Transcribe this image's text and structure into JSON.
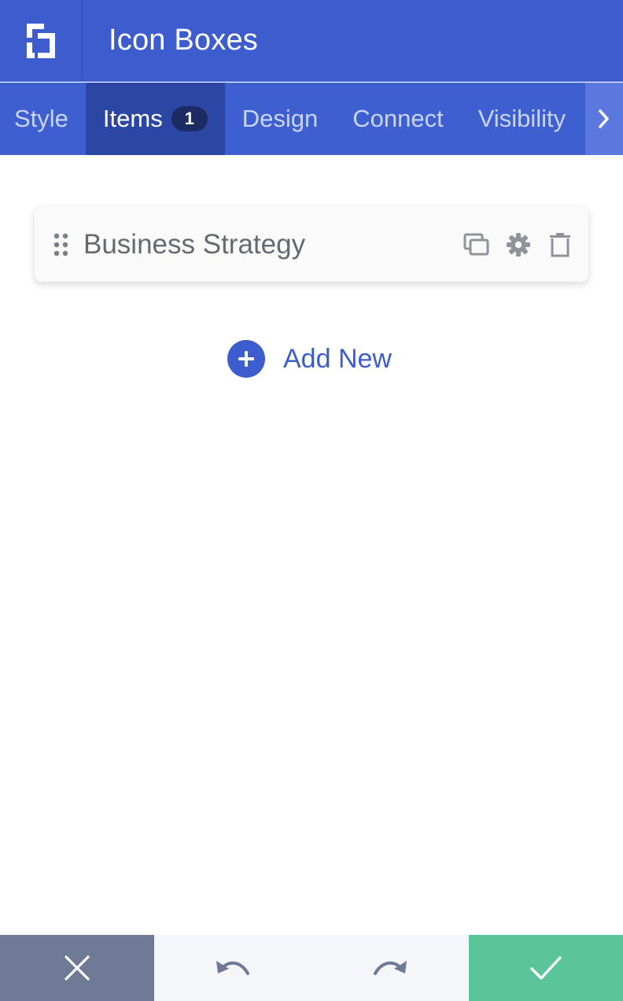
{
  "header": {
    "logo_icon": "builder-logo-icon",
    "title": "Icon Boxes"
  },
  "tabs": [
    {
      "label": "Style",
      "active": false
    },
    {
      "label": "Items",
      "active": true,
      "badge": "1"
    },
    {
      "label": "Design",
      "active": false
    },
    {
      "label": "Connect",
      "active": false
    },
    {
      "label": "Visibility",
      "active": false
    }
  ],
  "tab_scroll_icon": "chevron-right-icon",
  "items": [
    {
      "label": "Business Strategy",
      "icons": [
        "drag-handle-icon",
        "duplicate-icon",
        "settings-icon",
        "trash-icon"
      ]
    }
  ],
  "add_new": {
    "label": "Add New",
    "icon": "plus-circle-icon"
  },
  "footer": {
    "cancel_icon": "close-icon",
    "undo_icon": "undo-icon",
    "redo_icon": "redo-icon",
    "save_icon": "check-icon"
  },
  "colors": {
    "primary": "#3d5ccd",
    "active_tab": "#2c46a4",
    "badge": "#1c2b63",
    "cancel": "#6e7a96",
    "save": "#5ac49a",
    "footer_bg": "#f4f6fa"
  }
}
